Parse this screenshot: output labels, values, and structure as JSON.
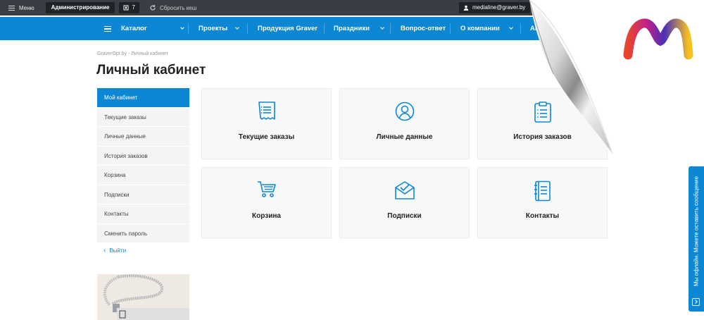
{
  "admin_bar": {
    "menu_label": "Меню",
    "admin_label": "Администрирование",
    "notifications_count": "7",
    "reset_cache_label": "Сбросить кеш",
    "user_email": "medialine@graver.by"
  },
  "nav": {
    "items": [
      "Каталог",
      "Проекты",
      "Продукция Graver",
      "Праздники",
      "Вопрос-ответ",
      "О компании",
      "Акции"
    ]
  },
  "breadcrumb": {
    "home": "GraverOpt.by",
    "separator": "-",
    "current": "Личный кабинет"
  },
  "page_title": "Личный кабинет",
  "sidebar": {
    "items": [
      {
        "label": "Мой кабинет",
        "active": true
      },
      {
        "label": "Текущие заказы",
        "active": false
      },
      {
        "label": "Личные данные",
        "active": false
      },
      {
        "label": "История заказов",
        "active": false
      },
      {
        "label": "Корзина",
        "active": false
      },
      {
        "label": "Подписки",
        "active": false
      },
      {
        "label": "Контакты",
        "active": false
      },
      {
        "label": "Сменить пароль",
        "active": false
      }
    ],
    "exit_label": "Выйти"
  },
  "tiles": [
    {
      "label": "Текущие заказы",
      "icon": "receipt-icon"
    },
    {
      "label": "Личные данные",
      "icon": "user-circle-icon"
    },
    {
      "label": "История заказов",
      "icon": "clipboard-list-icon"
    },
    {
      "label": "Корзина",
      "icon": "cart-icon"
    },
    {
      "label": "Подписки",
      "icon": "envelope-check-icon"
    },
    {
      "label": "Контакты",
      "icon": "notebook-icon"
    }
  ],
  "feedback": {
    "label": "Мы офлайн. Можете оставить сообщение"
  },
  "colors": {
    "accent": "#0d87d4",
    "admin_bar": "#3a3e44",
    "tile_bg": "#f7f8f9",
    "sidebar_bg": "#f3f4f5"
  }
}
